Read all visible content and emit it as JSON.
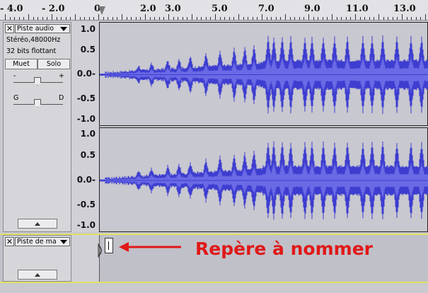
{
  "ruler": {
    "ticks": [
      "- 4.0",
      "- 2.0",
      "0",
      "2.0",
      "3.0",
      "5.0",
      "7.0",
      "9.0",
      "11.0",
      "13.0"
    ]
  },
  "audio_track": {
    "name": "Piste audio",
    "format": "Stéréo,48000Hz",
    "bits": "32 bits flottant",
    "mute_label": "Muet",
    "solo_label": "Solo",
    "gain_minus": "-",
    "gain_plus": "+",
    "pan_left": "G",
    "pan_right": "D",
    "scale": [
      "1.0",
      "0.5",
      "0.0-",
      "-0.5",
      "-1.0"
    ]
  },
  "label_track": {
    "name": "Piste de ma"
  },
  "annotation": "Repère à nommer",
  "colors": {
    "waveform": "#3d3dd0",
    "waveform_rms": "#6a6ae6",
    "annotation": "#e01818",
    "selection_border": "#e0e066"
  }
}
